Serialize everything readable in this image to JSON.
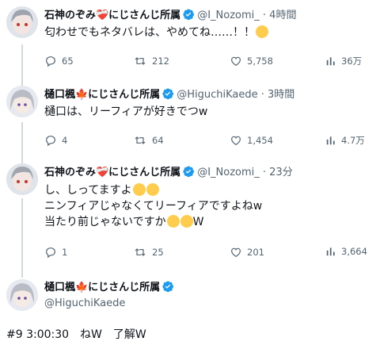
{
  "tweets": [
    {
      "name": "石神のぞみ❤️‍🩹にじさんじ所属",
      "handle": "@I_Nozomi_",
      "time": "4時間",
      "lines": [
        "匂わせでもネタバレは、やめてね……！！"
      ],
      "replies": "65",
      "retweets": "212",
      "likes": "5,758",
      "views": "36万"
    },
    {
      "name": "樋口楓🍁にじさんじ所属",
      "handle": "@HiguchiKaede",
      "time": "3時間",
      "lines": [
        "樋口は、リーフィアが好きでつw"
      ],
      "replies": "4",
      "retweets": "64",
      "likes": "1,454",
      "views": "4.7万"
    },
    {
      "name": "石神のぞみ❤️‍🩹にじさんじ所属",
      "handle": "@I_Nozomi_",
      "time": "23分",
      "lines": [
        "し、しってますよ",
        "ニンフィアじゃなくてリーフィアですよねw",
        "当たり前じゃないですか",
        "W"
      ],
      "replies": "1",
      "retweets": "25",
      "likes": "201",
      "views": "3,664"
    }
  ],
  "bottom_tweet": {
    "name": "樋口楓🍁にじさんじ所属",
    "handle": "@HiguchiKaede"
  },
  "footer": "#9 3:00:30　ねW　了解W",
  "colors": {
    "verified": "#1d9bf0",
    "text_secondary": "#536471",
    "thread_line": "#cfd9de"
  },
  "icons": [
    "reply-icon",
    "retweet-icon",
    "like-icon",
    "views-icon",
    "verified-badge-icon"
  ]
}
